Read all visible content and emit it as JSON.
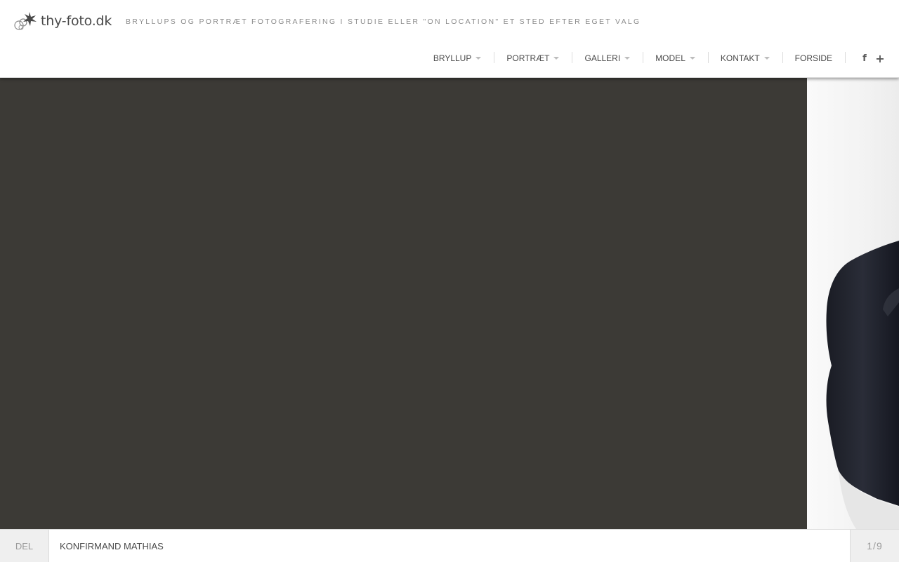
{
  "header": {
    "logo_text": "thy-foto.dk",
    "tagline": "BRYLLUPS OG PORTRÆT FOTOGRAFERING I STUDIE ELLER \"ON LOCATION\" ET STED EFTER EGET VALG"
  },
  "nav": {
    "items": [
      {
        "label": "BRYLLUP",
        "has_dropdown": true
      },
      {
        "label": "PORTRÆT",
        "has_dropdown": true
      },
      {
        "label": "GALLERI",
        "has_dropdown": true
      },
      {
        "label": "MODEL",
        "has_dropdown": true
      },
      {
        "label": "KONTAKT",
        "has_dropdown": true
      },
      {
        "label": "FORSIDE",
        "has_dropdown": false
      }
    ],
    "icons": [
      "facebook-icon",
      "plus-icon"
    ]
  },
  "slideshow": {
    "background_color": "#3c3a36"
  },
  "footer": {
    "share_label": "DEL",
    "caption": "KONFIRMAND MATHIAS",
    "counter": "1/9"
  }
}
